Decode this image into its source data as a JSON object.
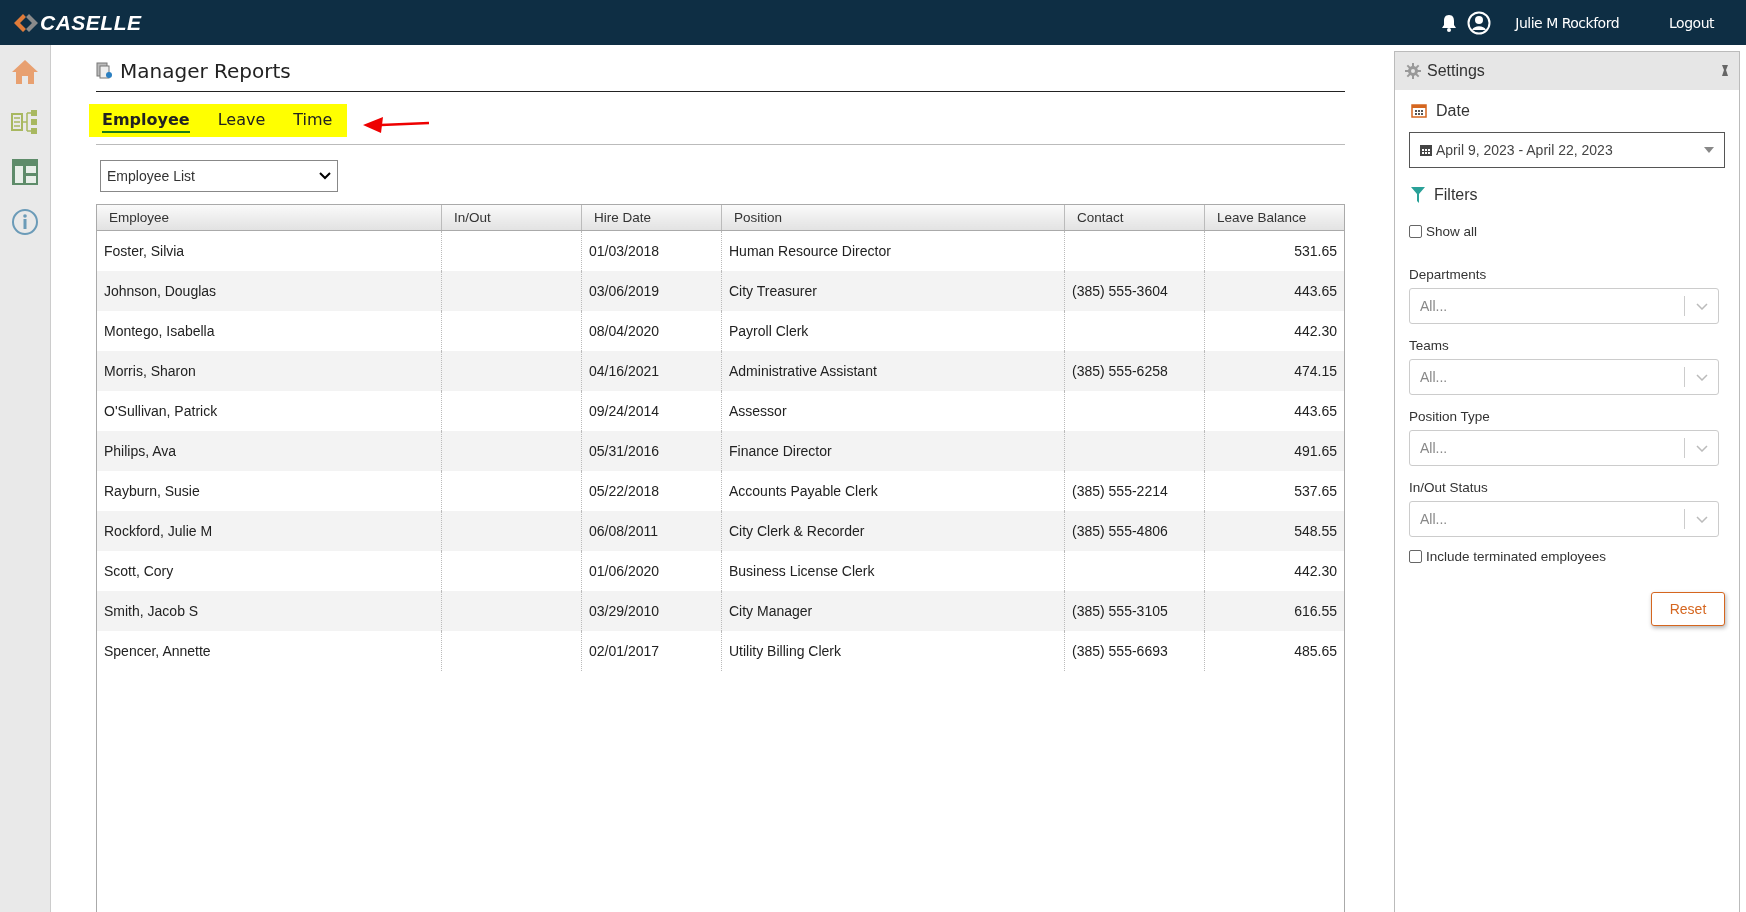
{
  "header": {
    "logo": "CASELLE",
    "user": "Julie M Rockford",
    "logout": "Logout"
  },
  "sidebar": {
    "items": [
      {
        "kind": "home"
      },
      {
        "kind": "tree"
      },
      {
        "kind": "layout"
      },
      {
        "kind": "info"
      }
    ]
  },
  "page": {
    "title": "Manager Reports"
  },
  "tabs": [
    {
      "label": "Employee",
      "selected": true
    },
    {
      "label": "Leave",
      "selected": false
    },
    {
      "label": "Time",
      "selected": false
    }
  ],
  "report_select": {
    "value": "Employee List"
  },
  "table": {
    "columns": [
      "Employee",
      "In/Out",
      "Hire Date",
      "Position",
      "Contact",
      "Leave Balance"
    ],
    "rows": [
      [
        "Foster, Silvia",
        "",
        "01/03/2018",
        "Human Resource Director",
        "",
        "531.65"
      ],
      [
        "Johnson, Douglas",
        "",
        "03/06/2019",
        "City Treasurer",
        "(385) 555-3604",
        "443.65"
      ],
      [
        "Montego, Isabella",
        "",
        "08/04/2020",
        "Payroll Clerk",
        "",
        "442.30"
      ],
      [
        "Morris, Sharon",
        "",
        "04/16/2021",
        "Administrative Assistant",
        "(385) 555-6258",
        "474.15"
      ],
      [
        "O'Sullivan, Patrick",
        "",
        "09/24/2014",
        "Assessor",
        "",
        "443.65"
      ],
      [
        "Philips, Ava",
        "",
        "05/31/2016",
        "Finance Director",
        "",
        "491.65"
      ],
      [
        "Rayburn, Susie",
        "",
        "05/22/2018",
        "Accounts Payable Clerk",
        "(385) 555-2214",
        "537.65"
      ],
      [
        "Rockford, Julie M",
        "",
        "06/08/2011",
        "City Clerk & Recorder",
        "(385) 555-4806",
        "548.55"
      ],
      [
        "Scott, Cory",
        "",
        "01/06/2020",
        "Business License Clerk",
        "",
        "442.30"
      ],
      [
        "Smith, Jacob S",
        "",
        "03/29/2010",
        "City Manager",
        "(385) 555-3105",
        "616.55"
      ],
      [
        "Spencer, Annette",
        "",
        "02/01/2017",
        "Utility Billing Clerk",
        "(385) 555-6693",
        "485.65"
      ]
    ]
  },
  "settings": {
    "title": "Settings",
    "date_heading": "Date",
    "date_range": "April 9, 2023 - April 22, 2023",
    "filters_heading": "Filters",
    "show_all": {
      "label": "Show all",
      "checked": false
    },
    "dropdowns": [
      {
        "label": "Departments",
        "placeholder": "All..."
      },
      {
        "label": "Teams",
        "placeholder": "All..."
      },
      {
        "label": "Position Type",
        "placeholder": "All..."
      },
      {
        "label": "In/Out Status",
        "placeholder": "All..."
      }
    ],
    "include_terminated": {
      "label": "Include terminated employees",
      "checked": false
    },
    "reset": "Reset"
  }
}
